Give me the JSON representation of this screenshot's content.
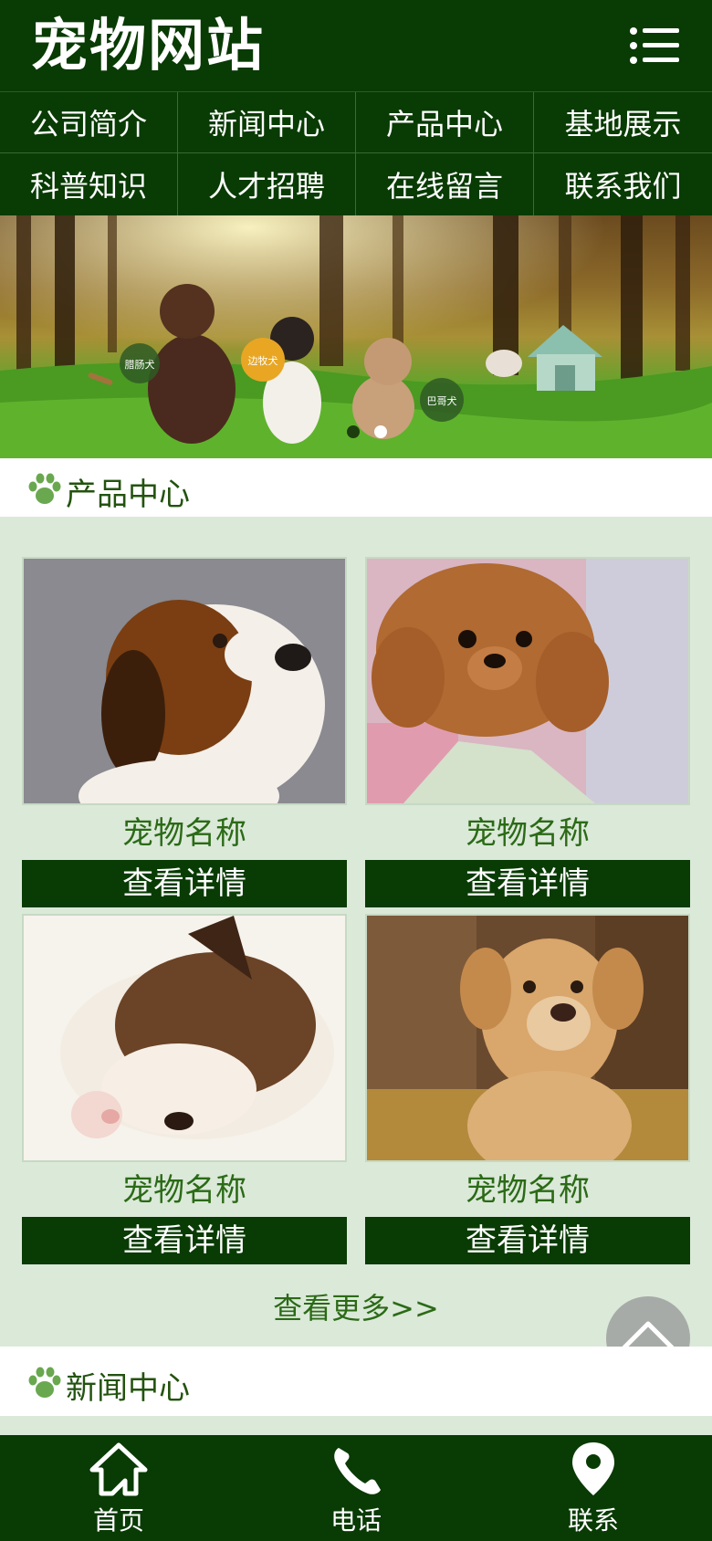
{
  "header": {
    "logo": "宠物网站",
    "menu_icon": "hamburger-menu-icon"
  },
  "nav": {
    "items": [
      {
        "label": "公司简介"
      },
      {
        "label": "新闻中心"
      },
      {
        "label": "产品中心"
      },
      {
        "label": "基地展示"
      },
      {
        "label": "科普知识"
      },
      {
        "label": "人才招聘"
      },
      {
        "label": "在线留言"
      },
      {
        "label": "联系我们"
      }
    ]
  },
  "banner": {
    "tags": [
      "腊肠犬",
      "边牧犬",
      "巴哥犬"
    ],
    "slides": 2,
    "active_slide": 1
  },
  "products_section": {
    "title": "产品中心",
    "icon": "paw-icon",
    "items": [
      {
        "name": "宠物名称",
        "button": "查看详情"
      },
      {
        "name": "宠物名称",
        "button": "查看详情"
      },
      {
        "name": "宠物名称",
        "button": "查看详情"
      },
      {
        "name": "宠物名称",
        "button": "查看详情"
      }
    ],
    "more": "查看更多>>"
  },
  "news_section": {
    "title": "新闻中心",
    "icon": "paw-icon"
  },
  "footer": {
    "items": [
      {
        "label": "首页",
        "icon": "home-icon"
      },
      {
        "label": "电话",
        "icon": "phone-icon"
      },
      {
        "label": "联系",
        "icon": "location-pin-icon"
      }
    ]
  },
  "colors": {
    "primary": "#093b04",
    "accent_text": "#2b6a16",
    "background": "#dbe9d9"
  }
}
